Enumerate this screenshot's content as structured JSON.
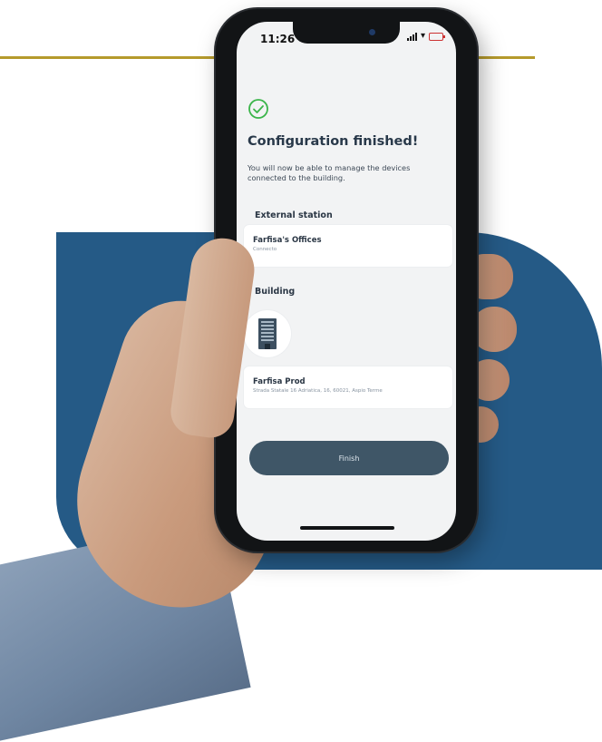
{
  "status_bar": {
    "time": "11:26"
  },
  "screen": {
    "title": "Configuration finished!",
    "subtitle": "You will now be able to manage the devices connected to the building.",
    "external_station": {
      "section_label": "External station",
      "name": "Farfisa's Offices",
      "status": "Connecto"
    },
    "building": {
      "section_label": "Building",
      "name": "Farfisa Prod",
      "address": "Strada Statale 16 Adriatica, 16, 60021, Aspio Terme"
    },
    "finish_label": "Finish"
  },
  "colors": {
    "accent_gold": "#b59a2c",
    "brand_blue": "#255a86",
    "success_green": "#3bb54a",
    "button_dark": "#3f5667"
  },
  "icons": [
    "check-circle-icon",
    "building-icon",
    "signal-icon",
    "wifi-icon",
    "battery-icon"
  ]
}
